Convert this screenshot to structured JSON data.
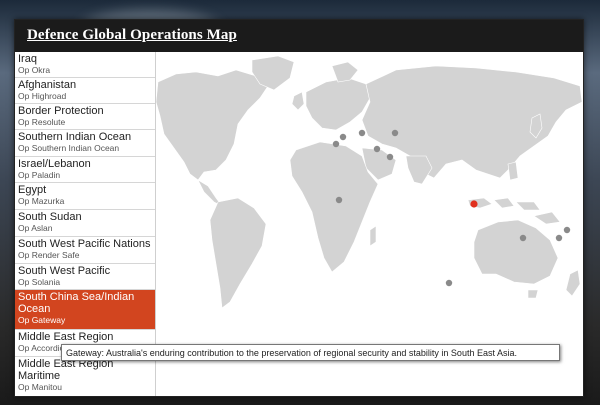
{
  "title": "Defence Global Operations Map",
  "operations": [
    {
      "name": "Iraq",
      "code": "Op Okra",
      "active": false
    },
    {
      "name": "Afghanistan",
      "code": "Op Highroad",
      "active": false
    },
    {
      "name": "Border Protection",
      "code": "Op Resolute",
      "active": false
    },
    {
      "name": "Southern Indian Ocean",
      "code": "Op Southern Indian Ocean",
      "active": false
    },
    {
      "name": "Israel/Lebanon",
      "code": "Op Paladin",
      "active": false
    },
    {
      "name": "Egypt",
      "code": "Op Mazurka",
      "active": false
    },
    {
      "name": "South Sudan",
      "code": "Op Aslan",
      "active": false
    },
    {
      "name": "South West Pacific Nations",
      "code": "Op Render Safe",
      "active": false
    },
    {
      "name": "South West Pacific",
      "code": "Op Solania",
      "active": false
    },
    {
      "name": "South China Sea/Indian Ocean",
      "code": "Op Gateway",
      "active": true
    },
    {
      "name": "Middle East Region",
      "code": "Op Accordion",
      "active": false
    },
    {
      "name": "Middle East Region Maritime",
      "code": "Op Manitou",
      "active": false
    }
  ],
  "tooltip": "Gateway: Australia's enduring contribution to the preservation of regional security and stability in South East Asia.",
  "colors": {
    "accent": "#d2451f",
    "marker": "#888888",
    "active_marker": "#e0301e",
    "land": "#d3d3d3"
  }
}
